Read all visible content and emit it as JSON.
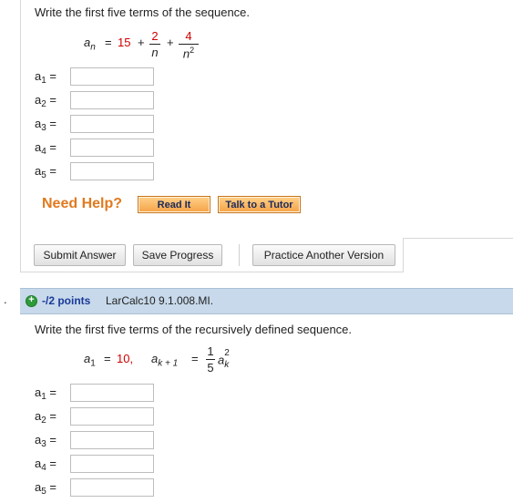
{
  "q1": {
    "prompt": "Write the first five terms of the sequence.",
    "formula": {
      "lhs_var": "a",
      "lhs_sub": "n",
      "eq": "=",
      "const": "15",
      "plus1": "+",
      "frac1_num": "2",
      "frac1_den": "n",
      "plus2": "+",
      "frac2_num": "4",
      "frac2_den": "n",
      "frac2_den_exp": "2"
    },
    "terms": [
      {
        "var": "a",
        "sub": "1",
        "eq": "=",
        "value": ""
      },
      {
        "var": "a",
        "sub": "2",
        "eq": "=",
        "value": ""
      },
      {
        "var": "a",
        "sub": "3",
        "eq": "=",
        "value": ""
      },
      {
        "var": "a",
        "sub": "4",
        "eq": "=",
        "value": ""
      },
      {
        "var": "a",
        "sub": "5",
        "eq": "=",
        "value": ""
      }
    ],
    "help": {
      "need_help": "Need Help?",
      "read_it": "Read It",
      "talk_tutor": "Talk to a Tutor"
    },
    "actions": {
      "submit": "Submit Answer",
      "save": "Save Progress",
      "practice": "Practice Another Version"
    }
  },
  "q2": {
    "number": ".",
    "plus_icon": "+",
    "points": "-/2 points",
    "source": "LarCalc10 9.1.008.MI.",
    "prompt": "Write the first five terms of the recursively defined sequence.",
    "formula": {
      "a1_var": "a",
      "a1_sub": "1",
      "eq1": "=",
      "a1_val": "10,",
      "ak_var": "a",
      "ak_sub": "k + 1",
      "eq2": "=",
      "frac_num": "1",
      "frac_den": "5",
      "tail_var": "a",
      "tail_sub": "k",
      "tail_exp": "2"
    },
    "terms": [
      {
        "var": "a",
        "sub": "1",
        "eq": "=",
        "value": ""
      },
      {
        "var": "a",
        "sub": "2",
        "eq": "=",
        "value": ""
      },
      {
        "var": "a",
        "sub": "3",
        "eq": "=",
        "value": ""
      },
      {
        "var": "a",
        "sub": "4",
        "eq": "=",
        "value": ""
      },
      {
        "var": "a",
        "sub": "5",
        "eq": "=",
        "value": ""
      }
    ]
  },
  "colors": {
    "answer_red": "#d00000",
    "need_help_orange": "#e07a1f",
    "header_blue": "#c7d9ea",
    "points_link": "#1a3a9a",
    "plus_icon_green": "#2e9a3a"
  },
  "icons": {
    "expand": "plus-circle-icon"
  }
}
